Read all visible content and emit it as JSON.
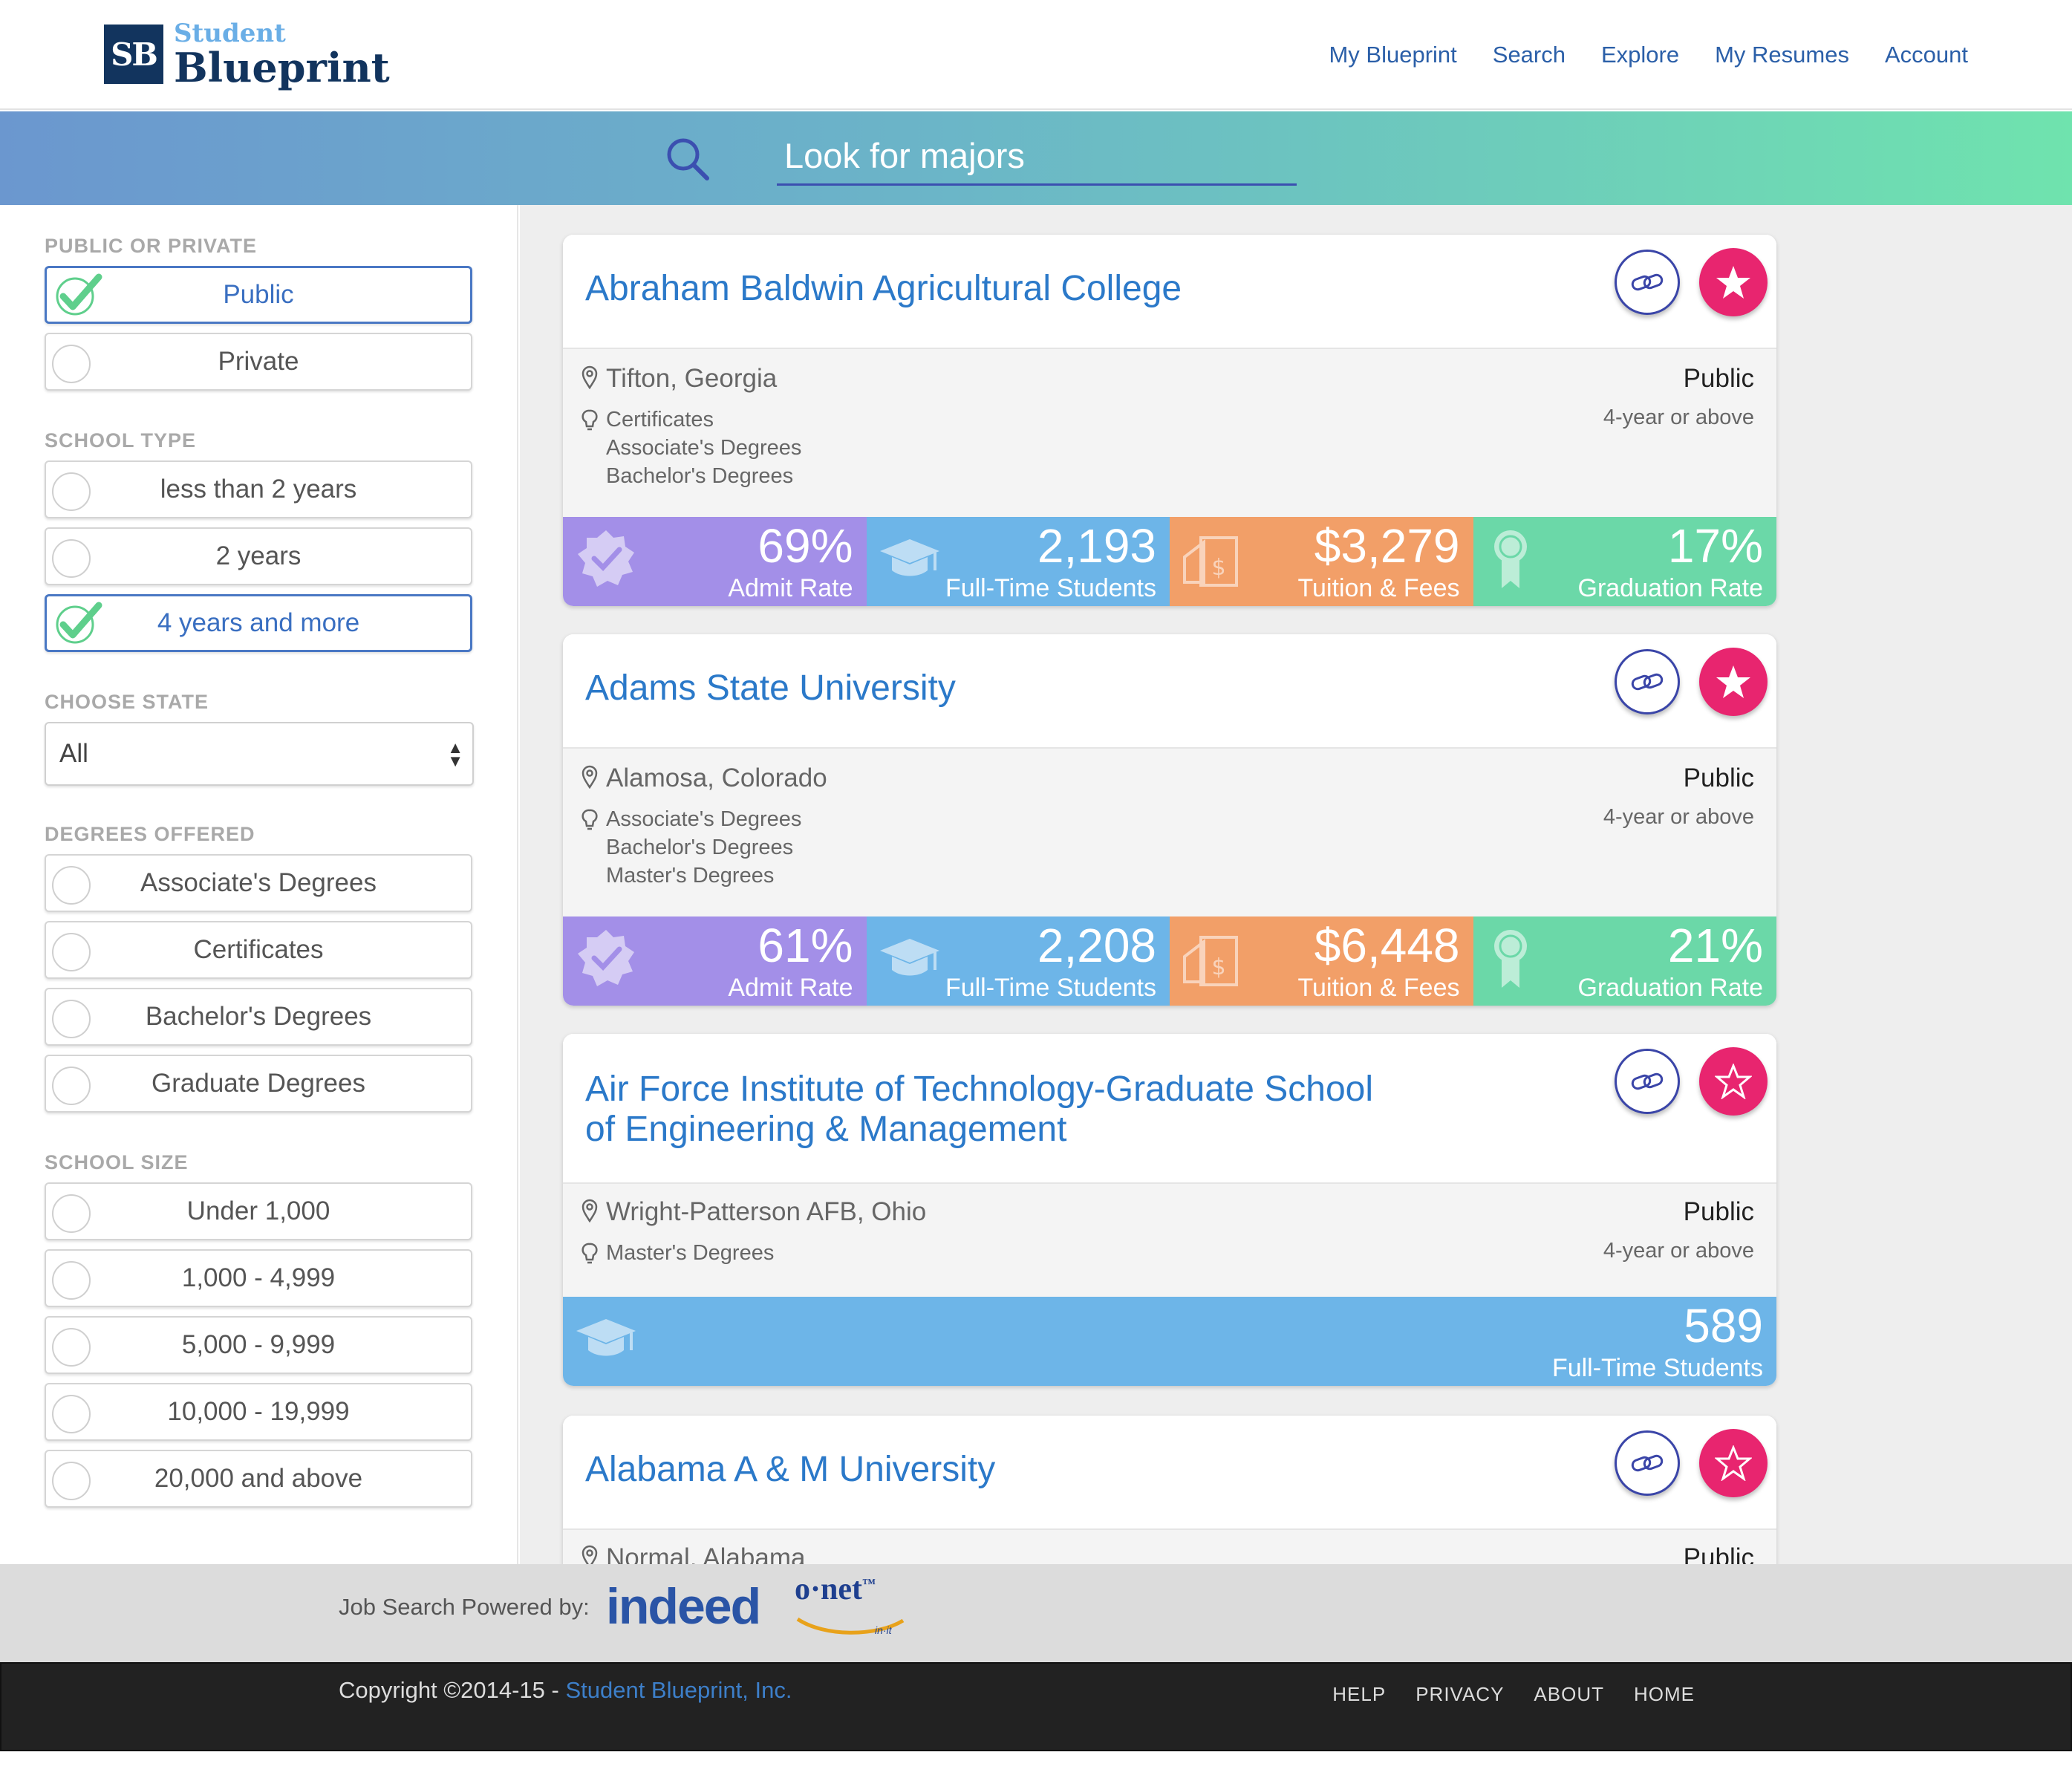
{
  "brand": {
    "mark": "SB",
    "small": "Student",
    "big": "Blueprint"
  },
  "nav": [
    "My Blueprint",
    "Search",
    "Explore",
    "My Resumes",
    "Account"
  ],
  "search": {
    "placeholder": "Look for majors"
  },
  "filters": {
    "public_private": {
      "title": "PUBLIC OR PRIVATE",
      "options": [
        {
          "label": "Public",
          "checked": true
        },
        {
          "label": "Private",
          "checked": false
        }
      ]
    },
    "school_type": {
      "title": "SCHOOL TYPE",
      "options": [
        {
          "label": "less than 2 years",
          "checked": false
        },
        {
          "label": "2 years",
          "checked": false
        },
        {
          "label": "4 years and more",
          "checked": true
        }
      ]
    },
    "state": {
      "title": "CHOOSE STATE",
      "value": "All"
    },
    "degrees": {
      "title": "DEGREES OFFERED",
      "options": [
        {
          "label": "Associate's Degrees",
          "checked": false
        },
        {
          "label": "Certificates",
          "checked": false
        },
        {
          "label": "Bachelor's Degrees",
          "checked": false
        },
        {
          "label": "Graduate Degrees",
          "checked": false
        }
      ]
    },
    "size": {
      "title": "SCHOOL SIZE",
      "options": [
        {
          "label": "Under 1,000",
          "checked": false
        },
        {
          "label": "1,000 - 4,999",
          "checked": false
        },
        {
          "label": "5,000 - 9,999",
          "checked": false
        },
        {
          "label": "10,000 - 19,999",
          "checked": false
        },
        {
          "label": "20,000 and above",
          "checked": false
        }
      ]
    }
  },
  "results": [
    {
      "name": "Abraham Baldwin Agricultural College",
      "location": "Tifton, Georgia",
      "degrees": [
        "Certificates",
        "Associate's Degrees",
        "Bachelor's Degrees"
      ],
      "control": "Public",
      "level": "4-year or above",
      "favorited": true,
      "stats": {
        "admit_rate": "69%",
        "admit_label": "Admit Rate",
        "students": "2,193",
        "students_label": "Full-Time Students",
        "tuition": "$3,279",
        "tuition_label": "Tuition & Fees",
        "grad_rate": "17%",
        "grad_label": "Graduation Rate"
      }
    },
    {
      "name": "Adams State University",
      "location": "Alamosa, Colorado",
      "degrees": [
        "Associate's Degrees",
        "Bachelor's Degrees",
        "Master's Degrees"
      ],
      "control": "Public",
      "level": "4-year or above",
      "favorited": true,
      "stats": {
        "admit_rate": "61%",
        "admit_label": "Admit Rate",
        "students": "2,208",
        "students_label": "Full-Time Students",
        "tuition": "$6,448",
        "tuition_label": "Tuition & Fees",
        "grad_rate": "21%",
        "grad_label": "Graduation Rate"
      }
    },
    {
      "name": "Air Force Institute of Technology-Graduate School of Engineering & Management",
      "location": "Wright-Patterson AFB, Ohio",
      "degrees": [
        "Master's Degrees"
      ],
      "control": "Public",
      "level": "4-year or above",
      "favorited": false,
      "stats": {
        "students": "589",
        "students_label": "Full-Time Students"
      }
    },
    {
      "name": "Alabama A & M University",
      "location": "Normal, Alabama",
      "control": "Public",
      "favorited": false
    }
  ],
  "footer": {
    "powered_label": "Job Search Powered by:",
    "indeed": "indeed",
    "onet": "o·net",
    "onet_tm": "™",
    "onet_tag": "in·it",
    "copyright": "Copyright ©2014-15 - ",
    "company": "Student Blueprint, Inc.",
    "links": [
      "HELP",
      "PRIVACY",
      "ABOUT",
      "HOME"
    ]
  },
  "colors": {
    "accent": "#2b79c9",
    "star": "#e8256f",
    "admit": "#a38fe8",
    "students": "#6db5e8",
    "tuition": "#f29f68",
    "grad": "#6bd8a8"
  }
}
